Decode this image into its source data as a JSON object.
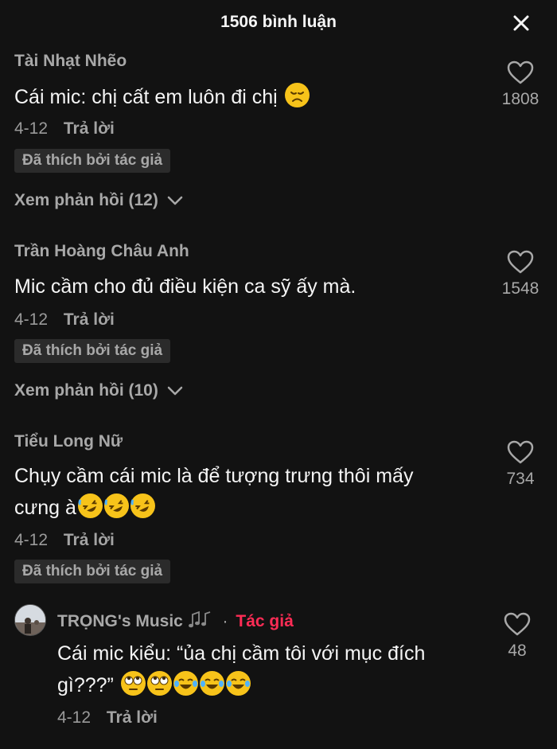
{
  "header": {
    "title": "1506 bình luận",
    "close_icon": "close-icon"
  },
  "comments": [
    {
      "username": "Tài Nhạt Nhẽo",
      "text": "Cái mic: chị cất em luôn đi chị",
      "emoji": "disappointed-face-emoji",
      "date": "4-12",
      "reply_label": "Trả lời",
      "badge": "Đã thích bởi tác giả",
      "view_replies": "Xem phản hồi (12)",
      "likes": "1808"
    },
    {
      "username": "Trần Hoàng Châu Anh",
      "text": "Mic cầm cho đủ điều kiện ca sỹ ấy mà.",
      "date": "4-12",
      "reply_label": "Trả lời",
      "badge": "Đã thích bởi tác giả",
      "view_replies": "Xem phản hồi (10)",
      "likes": "1548"
    },
    {
      "username": "Tiểu Long Nữ",
      "text_line1": "Chụy cầm cái mic là để tượng trưng thôi mấy",
      "text_line2": "cưng à",
      "emojis": [
        "rolling-on-floor-laughing-emoji",
        "rolling-on-floor-laughing-emoji",
        "rolling-on-floor-laughing-emoji"
      ],
      "date": "4-12",
      "reply_label": "Trả lời",
      "badge": "Đã thích bởi tác giả",
      "likes": "734"
    }
  ],
  "author_reply": {
    "username": "TRỌNG's Music",
    "music_icon": "music-notes-icon",
    "separator": "·",
    "author_tag": "Tác giả",
    "text_line1": "Cái mic kiểu: “ủa chị cầm tôi với mục đích",
    "text_line2": "gì???”",
    "emojis": [
      "eye-roll-emoji",
      "eye-roll-emoji",
      "tears-of-joy-emoji",
      "tears-of-joy-emoji",
      "tears-of-joy-emoji"
    ],
    "date": "4-12",
    "reply_label": "Trả lời",
    "likes": "48"
  },
  "colors": {
    "background": "#121212",
    "accent": "#fe2c55",
    "muted": "#a8a8a8",
    "badge_bg": "#2b2b2b"
  }
}
